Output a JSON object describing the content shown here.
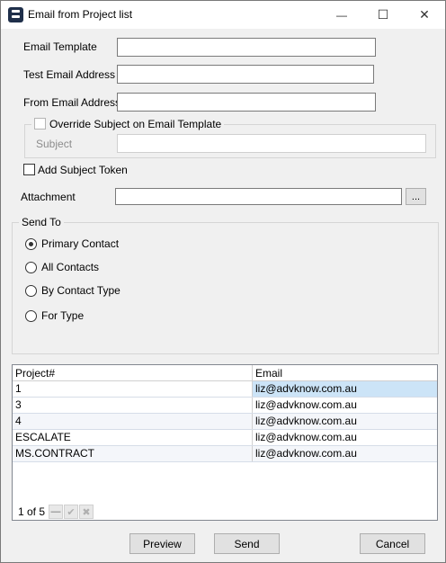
{
  "window": {
    "title": "Email from Project list",
    "minimize_glyph": "—",
    "maximize_glyph": "☐",
    "close_glyph": "✕"
  },
  "form": {
    "email_template_label": "Email Template",
    "email_template_value": "",
    "test_email_label": "Test Email Address",
    "test_email_value": "",
    "from_email_label": "From Email Address",
    "from_email_value": "",
    "override_subject_label": "Override Subject on Email Template",
    "override_subject_checked": false,
    "subject_label": "Subject",
    "subject_value": "",
    "add_subject_token_label": "Add Subject Token",
    "add_subject_token_checked": false,
    "attachment_label": "Attachment",
    "attachment_value": "",
    "browse_label": "..."
  },
  "send_to": {
    "legend": "Send To",
    "options": [
      {
        "label": "Primary Contact",
        "checked": true
      },
      {
        "label": "All Contacts",
        "checked": false
      },
      {
        "label": "By Contact Type",
        "checked": false
      },
      {
        "label": "For Type",
        "checked": false
      }
    ]
  },
  "grid": {
    "columns": [
      "Project#",
      "Email"
    ],
    "rows": [
      {
        "project": "1",
        "email": "liz@advknow.com.au"
      },
      {
        "project": "3",
        "email": "liz@advknow.com.au"
      },
      {
        "project": "4",
        "email": "liz@advknow.com.au"
      },
      {
        "project": "ESCALATE",
        "email": "liz@advknow.com.au"
      },
      {
        "project": "MS.CONTRACT",
        "email": "liz@advknow.com.au"
      }
    ],
    "selected_row": 0,
    "pager_text": "1 of 5",
    "pager_icons": [
      "minus-icon",
      "check-icon",
      "close-icon"
    ]
  },
  "buttons": {
    "preview": "Preview",
    "send": "Send",
    "cancel": "Cancel"
  }
}
